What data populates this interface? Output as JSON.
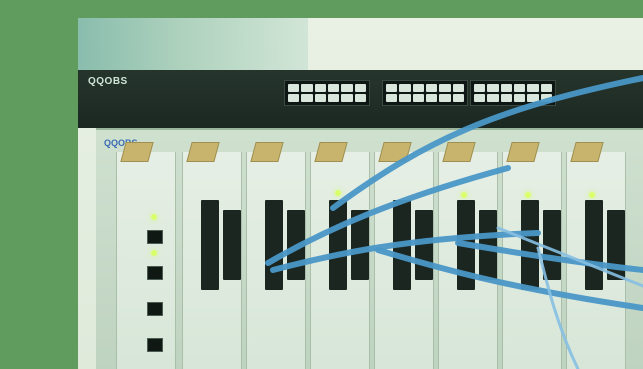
{
  "image": {
    "labels": {
      "switch_brand": "QQOBS",
      "chassis_brand": "QQOBS"
    },
    "colors": {
      "background": "#5f9c5e",
      "photo_bg": "#e8f1e4",
      "switch": "#1b2822",
      "chassis": "#cfe0cf",
      "cable": "#4a97c7",
      "led": "#d8ff6a"
    },
    "icons": [
      "network-switch-icon",
      "rack-chassis-icon",
      "ethernet-cable-icon",
      "status-led-icon"
    ]
  }
}
